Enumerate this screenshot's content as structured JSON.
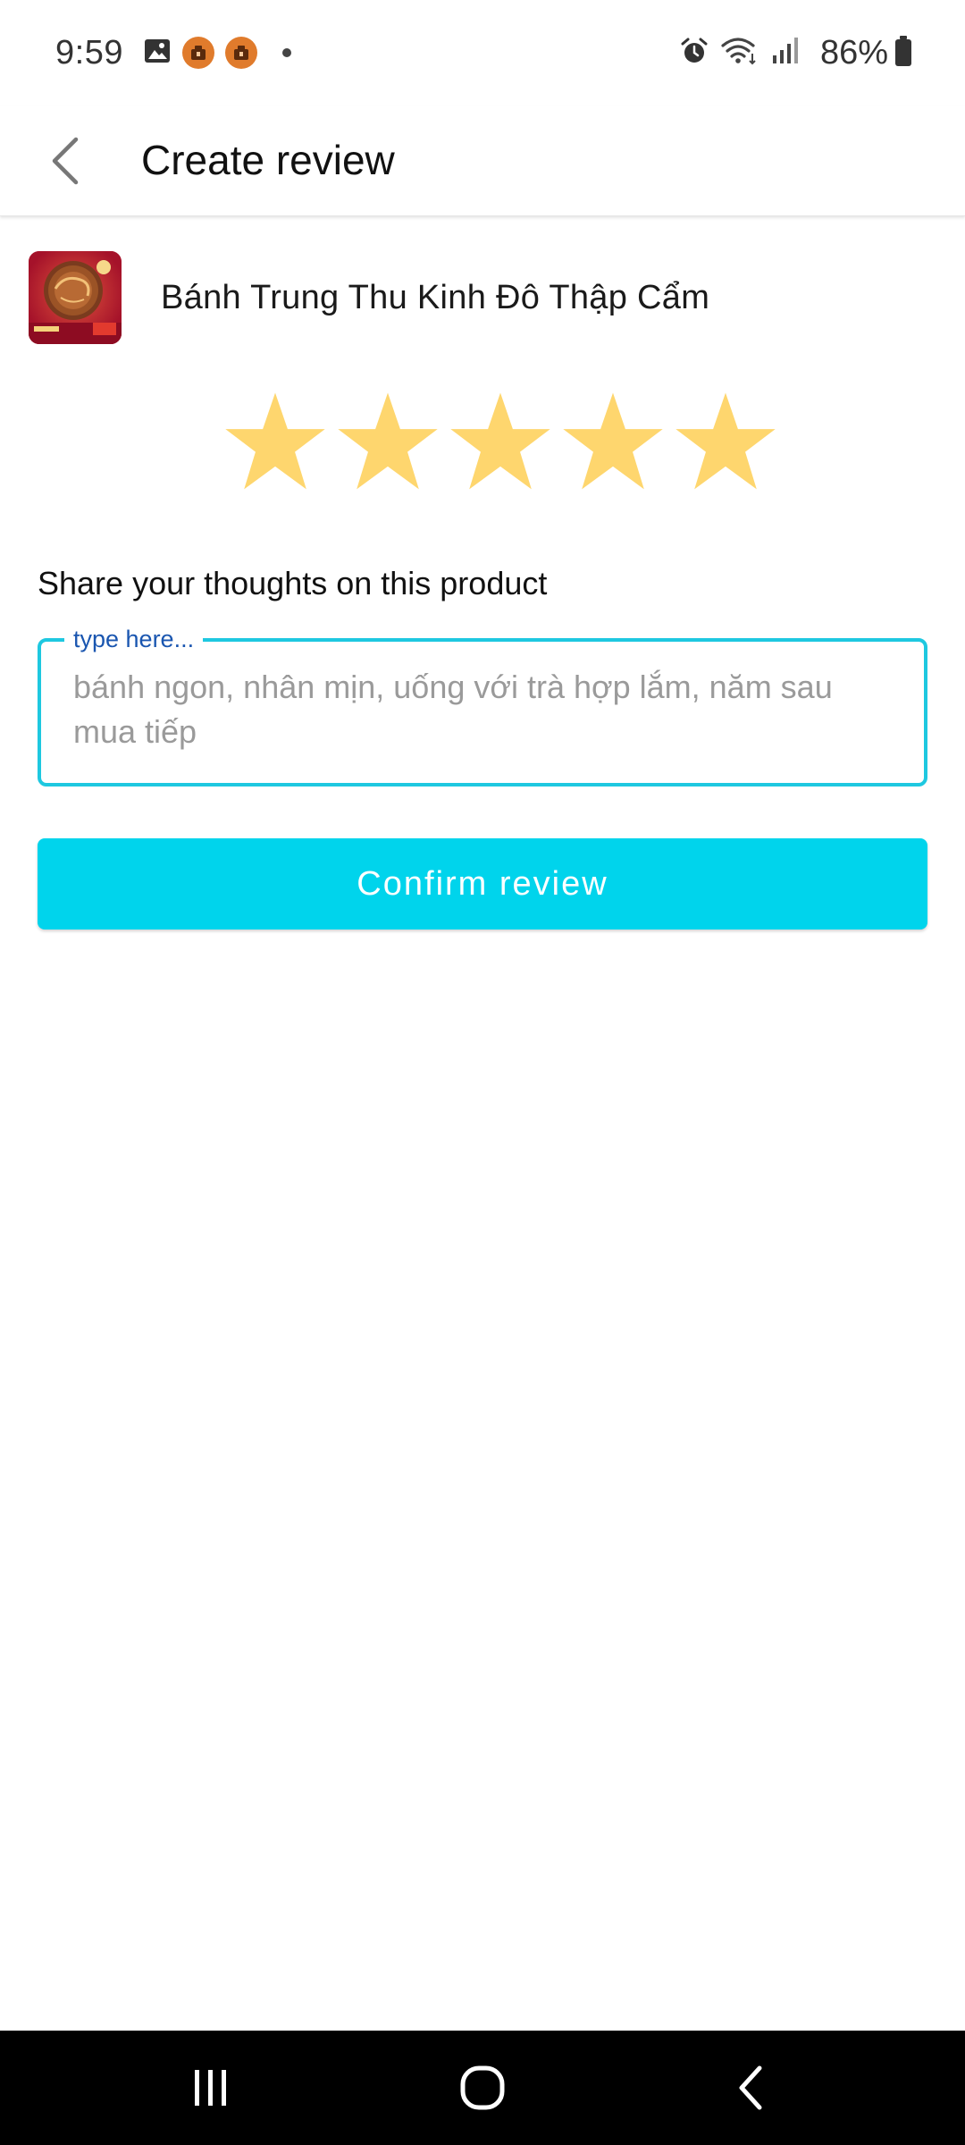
{
  "status_bar": {
    "time": "9:59",
    "battery": "86%",
    "icons": [
      "gallery-icon",
      "app-notification-icon",
      "app-notification-icon",
      "dot-icon",
      "alarm-icon",
      "wifi-icon",
      "signal-icon",
      "battery-icon"
    ]
  },
  "header": {
    "title": "Create review",
    "back_icon": "chevron-left-icon"
  },
  "product": {
    "name": "Bánh Trung Thu Kinh Đô Thập Cẩm",
    "image_icon": "product-thumbnail"
  },
  "rating": {
    "value": 5,
    "max": 5,
    "star_color": "#fed66e"
  },
  "review": {
    "prompt": "Share your thoughts on this product",
    "field_label": "type here...",
    "placeholder": "bánh ngon, nhân mịn, uống với trà hợp lắm, năm sau mua tiếp",
    "value": ""
  },
  "confirm": {
    "label": "Confirm review",
    "color": "#00d4ec"
  },
  "colors": {
    "accent": "#00d4ec",
    "field_border": "#1ec8e0",
    "field_label": "#1a56b0"
  },
  "navigation": {
    "icons": [
      "recents-icon",
      "home-icon",
      "back-icon"
    ]
  }
}
